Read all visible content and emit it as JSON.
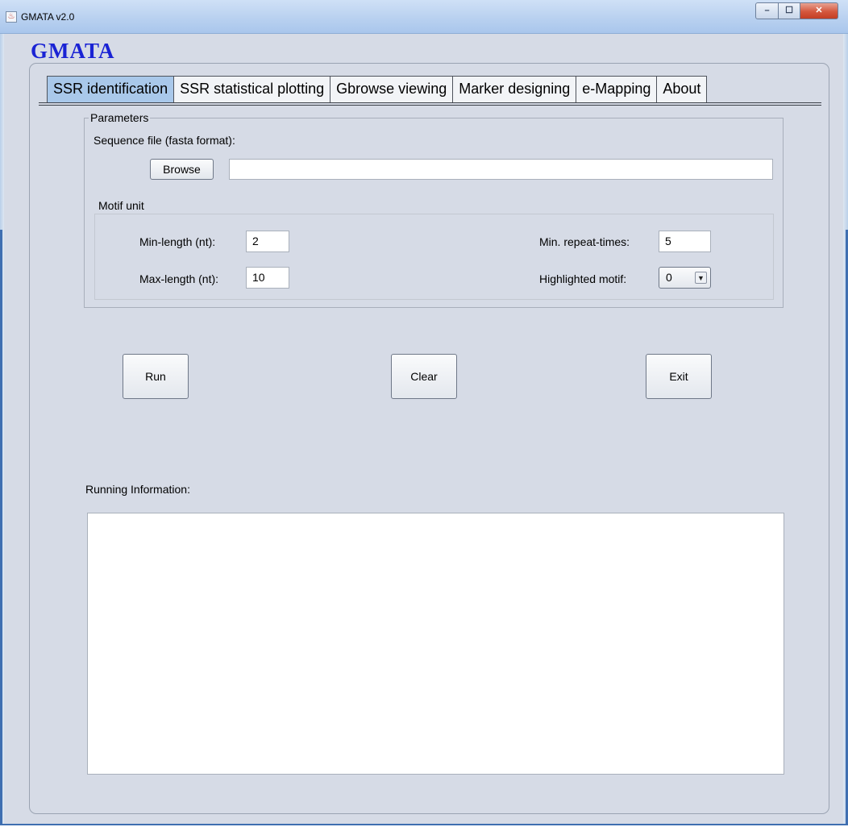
{
  "window": {
    "title": "GMATA v2.0",
    "controls": {
      "minimize": "–",
      "maximize": "☐",
      "close": "✕"
    }
  },
  "app": {
    "logo": "GMATA"
  },
  "tabs": [
    {
      "label": "SSR identification",
      "active": true
    },
    {
      "label": "SSR statistical plotting",
      "active": false
    },
    {
      "label": "Gbrowse viewing",
      "active": false
    },
    {
      "label": "Marker designing",
      "active": false
    },
    {
      "label": "e-Mapping",
      "active": false
    },
    {
      "label": "About",
      "active": false
    }
  ],
  "parameters": {
    "legend": "Parameters",
    "sequence_file_label": "Sequence file (fasta format):",
    "browse_label": "Browse",
    "file_path_value": "",
    "motif_unit_label": "Motif unit",
    "min_length_label": "Min-length (nt):",
    "min_length_value": "2",
    "max_length_label": "Max-length (nt):",
    "max_length_value": "10",
    "min_repeat_label": "Min. repeat-times:",
    "min_repeat_value": "5",
    "highlighted_motif_label": "Highlighted motif:",
    "highlighted_motif_value": "0"
  },
  "actions": {
    "run": "Run",
    "clear": "Clear",
    "exit": "Exit"
  },
  "running_info": {
    "label": "Running Information:",
    "content": ""
  },
  "colors": {
    "window_bg": "#d6dbe6",
    "logo": "#1a23d4",
    "active_tab": "#a9c8ea",
    "title_bar": "#b9d1f0",
    "close_button": "#c33e24"
  }
}
